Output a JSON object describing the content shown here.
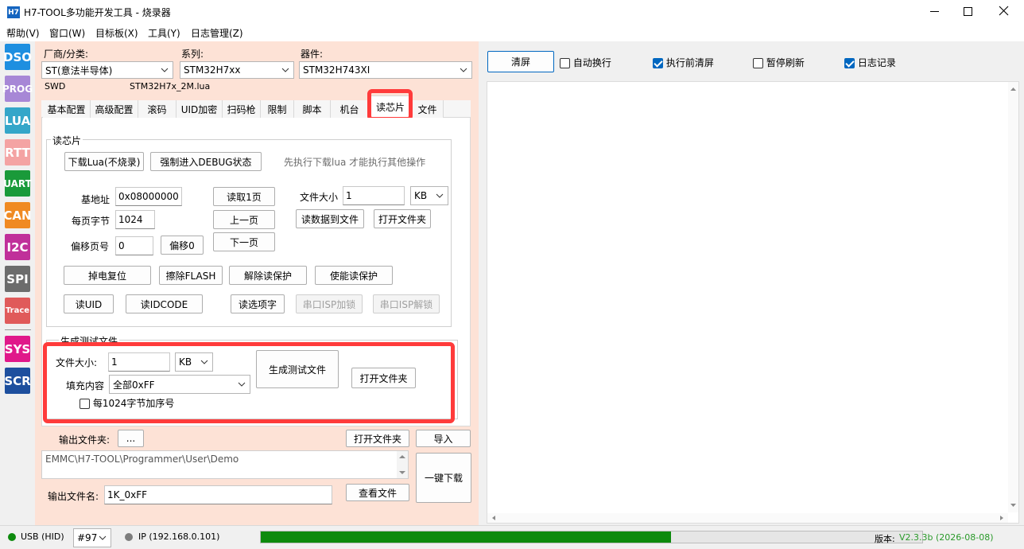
{
  "window": {
    "icon_text": "H7",
    "title": "H7-TOOL多功能开发工具 - 烧录器"
  },
  "menu": [
    "帮助(V)",
    "窗口(W)",
    "目标板(X)",
    "工具(Y)",
    "日志管理(Z)"
  ],
  "sidebar": [
    {
      "label": "DSO",
      "color": "#1e8fe0"
    },
    {
      "label": "PROG",
      "color": "#a787d6"
    },
    {
      "label": "LUA",
      "color": "#34a6c9"
    },
    {
      "label": "RTT",
      "color": "#f4a3a3"
    },
    {
      "label": "UART",
      "color": "#1a9a3a"
    },
    {
      "label": "CAN",
      "color": "#f08a22"
    },
    {
      "label": "I2C",
      "color": "#c0309a"
    },
    {
      "label": "SPI",
      "color": "#6c6c6c"
    },
    {
      "label": "Trace",
      "color": "#e05a5a"
    },
    {
      "label": "SYS",
      "color": "#e0188a"
    },
    {
      "label": "SCR",
      "color": "#1d4f9e"
    }
  ],
  "device": {
    "vendor_label": "厂商/分类:",
    "vendor_value": "ST(意法半导体)",
    "series_label": "系列:",
    "series_value": "STM32H7xx",
    "part_label": "器件:",
    "part_value": "STM32H743XI",
    "interface": "SWD",
    "lua_file": "STM32H7x_2M.lua"
  },
  "tabs": [
    "基本配置",
    "高级配置",
    "滚码",
    "UID加密",
    "扫码枪",
    "限制",
    "脚本",
    "机台",
    "读芯片",
    "文件"
  ],
  "read_chip": {
    "group_title": "读芯片",
    "download_lua": "下载Lua(不烧录)",
    "force_debug": "强制进入DEBUG状态",
    "hint": "先执行下载lua 才能执行其他操作",
    "base_addr_label": "基地址",
    "base_addr_value": "0x08000000",
    "page_bytes_label": "每页字节",
    "page_bytes_value": "1024",
    "offset_page_label": "偏移页号",
    "offset_page_value": "0",
    "offset0": "偏移0",
    "read_page": "读取1页",
    "prev_page": "上一页",
    "next_page": "下一页",
    "file_size_label": "文件大小",
    "file_size_value": "1",
    "file_size_unit": "KB",
    "read_to_file": "读数据到文件",
    "open_folder": "打开文件夹",
    "power_reset": "掉电复位",
    "erase_flash": "擦除FLASH",
    "unprotect": "解除读保护",
    "protect": "使能读保护",
    "read_uid": "读UID",
    "read_idcode": "读IDCODE",
    "read_option": "读选项字",
    "isp_lock": "串口ISP加锁",
    "isp_unlock": "串口ISP解锁"
  },
  "gen_test": {
    "group_title": "生成测试文件",
    "size_label": "文件大小:",
    "size_value": "1",
    "size_unit": "KB",
    "fill_label": "填充内容",
    "fill_value": "全部0xFF",
    "seq_label": "每1024字节加序号",
    "generate": "生成测试文件",
    "open_folder": "打开文件夹"
  },
  "output": {
    "folder_label": "输出文件夹:",
    "browse": "...",
    "open_folder": "打开文件夹",
    "import": "导入",
    "path": "EMMC\\H7-TOOL\\Programmer\\User\\Demo",
    "one_click": "一键下载",
    "name_label": "输出文件名:",
    "name_value": "1K_0xFF",
    "view_file": "查看文件"
  },
  "log": {
    "clear": "清屏",
    "auto_wrap": "自动换行",
    "auto_wrap_checked": false,
    "clear_before": "执行前清屏",
    "clear_before_checked": true,
    "pause_refresh": "暂停刷新",
    "pause_refresh_checked": false,
    "log_record": "日志记录",
    "log_record_checked": true
  },
  "status": {
    "usb": "USB (HID)",
    "device_num": "#97",
    "ip": "IP (192.168.0.101)",
    "progress": 0.62,
    "version_label": "版本:",
    "version_value": "V2.3.3b (2026-08-08)"
  },
  "colors": {
    "panel_bg": "#fde2d6",
    "highlight": "#ff3b3b",
    "progress": "#0d8a0d",
    "version": "#2a9a2a"
  }
}
